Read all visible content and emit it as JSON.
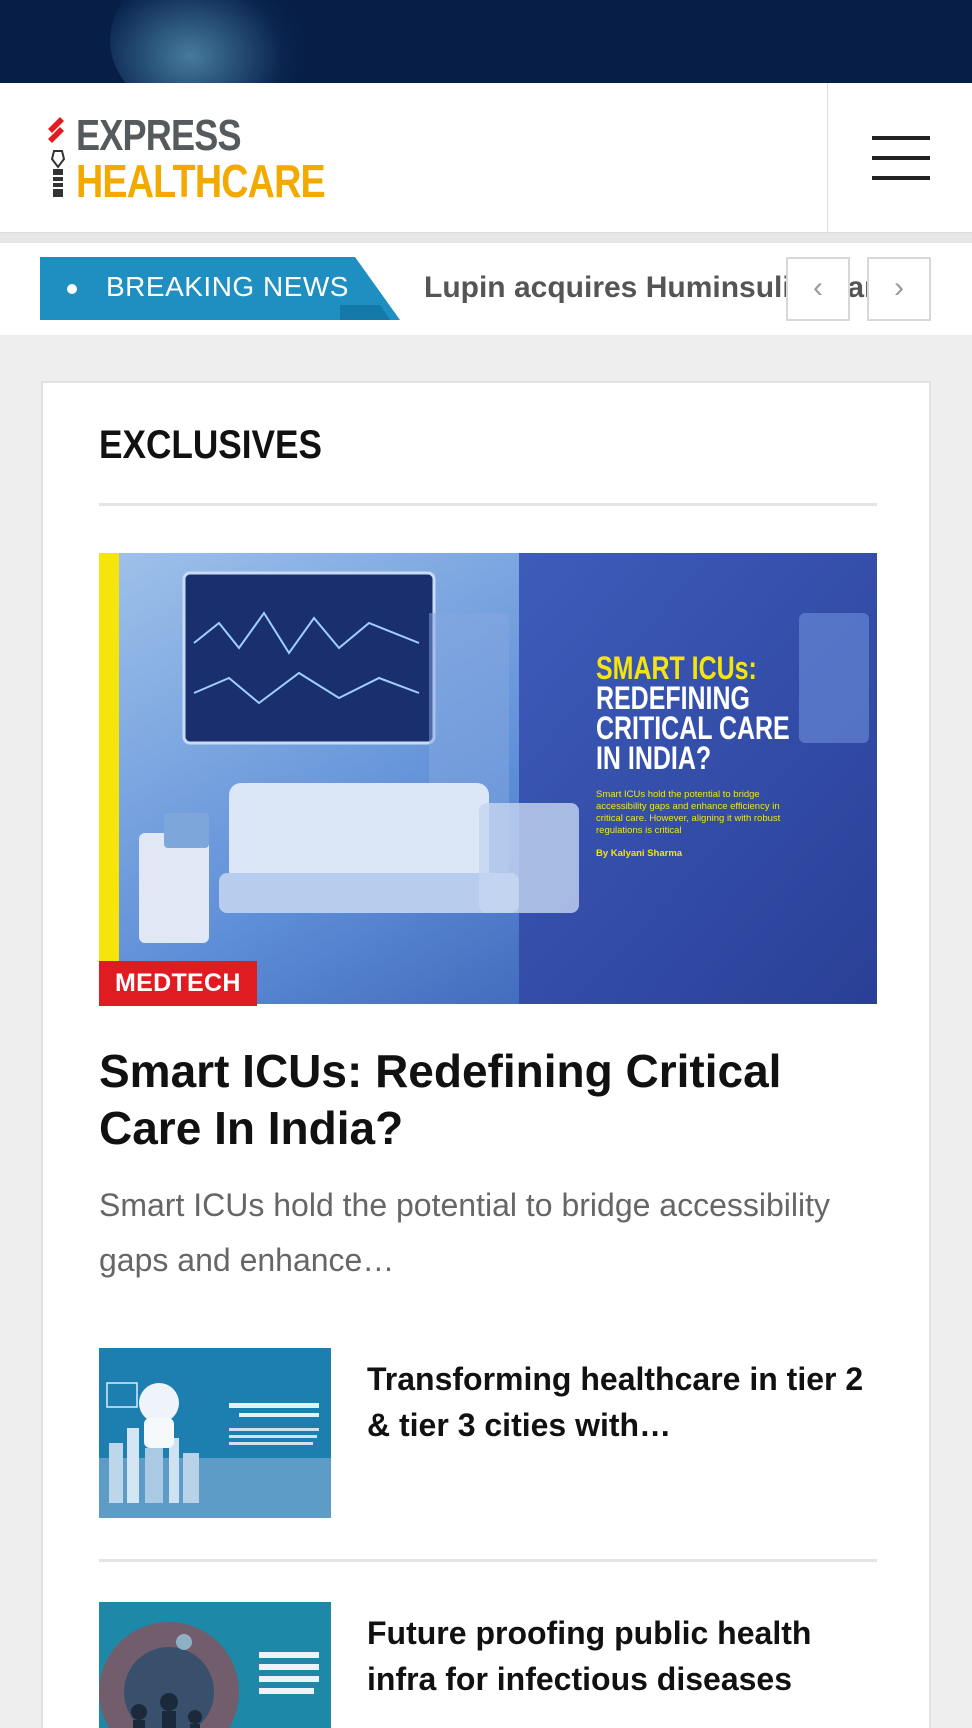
{
  "header": {
    "logo_line1": "EXPRESS",
    "logo_line2": "HEALTHCARE",
    "menu_icon": "hamburger-menu-icon"
  },
  "ticker": {
    "label": "BREAKING NEWS",
    "headline": "Lupin acquires Huminsulin brand In",
    "prev_icon": "chevron-left-icon",
    "next_icon": "chevron-right-icon",
    "prev_symbol": "‹",
    "next_symbol": "›"
  },
  "exclusives": {
    "title": "EXCLUSIVES",
    "hero": {
      "image_title_line1": "SMART ICUs:",
      "image_title_line2": "REDEFINING",
      "image_title_line3": "CRITICAL CARE",
      "image_title_line4": "IN INDIA?",
      "image_subtitle": "Smart ICUs hold the potential to bridge accessibility gaps and enhance efficiency in critical care. However, aligning it with robust regulations is critical",
      "image_byline": "By Kalyani Sharma",
      "category": "MEDTECH",
      "headline": "Smart ICUs: Redefining Critical Care In India?",
      "excerpt": "Smart ICUs hold the potential to bridge accessibility gaps and enhance…"
    },
    "items": [
      {
        "title": "Transforming healthcare in tier 2 & tier 3 cities with…"
      },
      {
        "title": "Future proofing public health infra for infectious diseases"
      }
    ]
  },
  "colors": {
    "banner": "#071e46",
    "breaking_blue": "#1f8ec0",
    "logo_grey": "#555a5e",
    "logo_yellow": "#f2a900",
    "badge_red": "#e01b22"
  }
}
